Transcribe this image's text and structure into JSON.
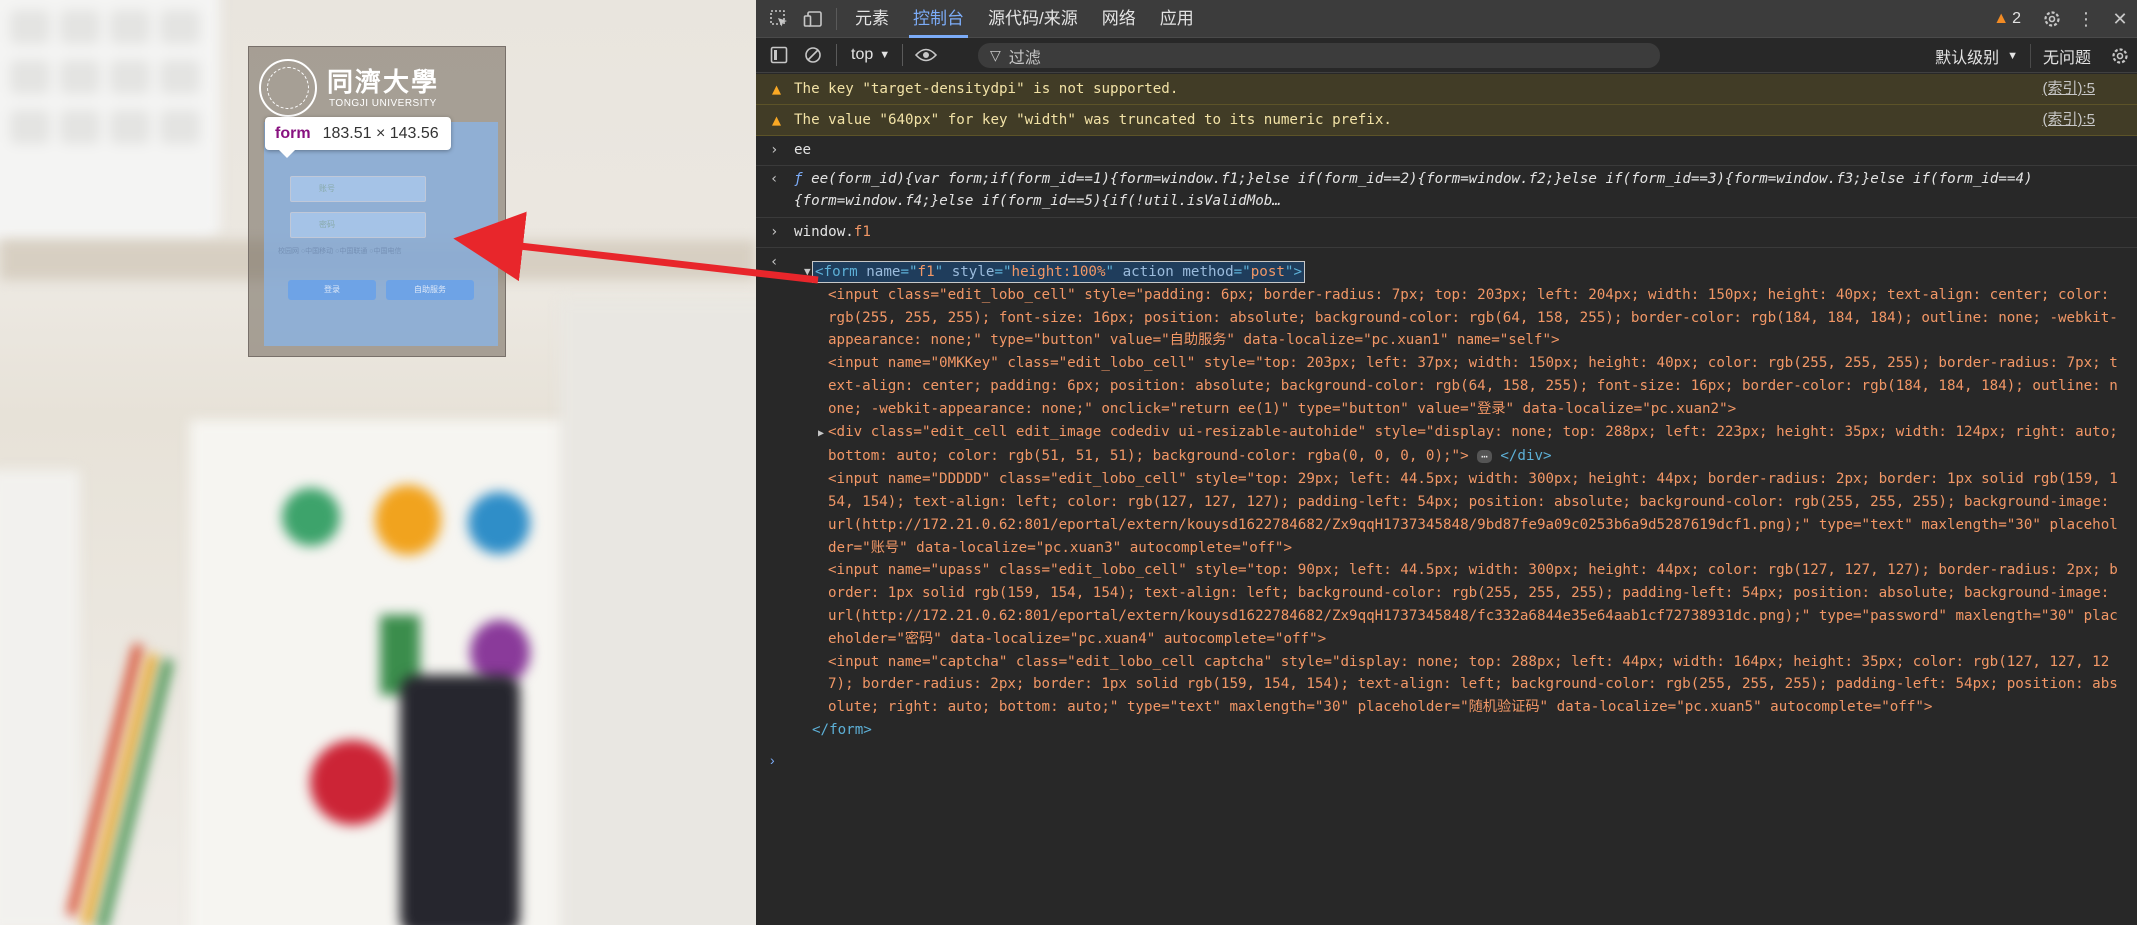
{
  "page": {
    "tongji_name_cn": "同濟大學",
    "tongji_name_en": "TONGJI UNIVERSITY",
    "login_form": {
      "account_placeholder": "账号",
      "password_placeholder": "密码",
      "radio_options": "校园网  ○中国移动  ○中国联通  ○中国电信",
      "login_btn": "登录",
      "self_service_btn": "自助服务"
    },
    "inspect_tooltip": {
      "tag": "form",
      "dims": "183.51 × 143.56"
    }
  },
  "devtools": {
    "tabs": [
      {
        "label": "元素",
        "active": false
      },
      {
        "label": "控制台",
        "active": true
      },
      {
        "label": "源代码/来源",
        "active": false
      },
      {
        "label": "网络",
        "active": false
      },
      {
        "label": "应用",
        "active": false
      }
    ],
    "issue_count": "2",
    "toolbar": {
      "context": "top",
      "filter_placeholder": "过滤",
      "level": "默认级别",
      "issues": "无问题"
    },
    "console": {
      "warnings": [
        {
          "text": "The key \"target-densitydpi\" is not supported.",
          "link": "(索引):5"
        },
        {
          "text": "The value \"640px\" for key \"width\" was truncated to its numeric prefix.",
          "link": "(索引):5"
        }
      ],
      "input1": "ee",
      "fn_output_line1": "ee(form_id){var form;if(form_id==1){form=window.f1;}else if(form_id==2){form=window.f2;}else if(form_id==3){form=window.f3;}else if(form_id==4)",
      "fn_output_line2": "{form=window.f4;}else if(form_id==5){if(!util.isValidMob…",
      "input2_obj": "window.",
      "input2_prop": "f1",
      "form_open": {
        "tag": "form",
        "name": "f1",
        "style": "height:100%",
        "action": "action",
        "method": "post"
      },
      "children": [
        {
          "id": "input1",
          "text": "<input class=\"edit_lobo_cell\" style=\"padding: 6px; border-radius: 7px; top: 203px; left: 204px; width: 150px; height: 40px; text-align: center; color: rgb(255, 255, 255); font-size: 16px; position: absolute; background-color: rgb(64, 158, 255); border-color: rgb(184, 184, 184); outline: none; -webkit-appearance: none;\" type=\"button\" value=\"自助服务\" data-localize=\"pc.xuan1\" name=\"self\">"
        },
        {
          "id": "input2",
          "text": "<input name=\"0MKKey\" class=\"edit_lobo_cell\" style=\"top: 203px; left: 37px; width: 150px; height: 40px; color: rgb(255, 255, 255); border-radius: 7px; text-align: center; padding: 6px; position: absolute; background-color: rgb(64, 158, 255); font-size: 16px; border-color: rgb(184, 184, 184); outline: none; -webkit-appearance: none;\" onclick=\"return ee(1)\" type=\"button\" value=\"登录\" data-localize=\"pc.xuan2\">"
        },
        {
          "id": "div1",
          "text": "<div class=\"edit_cell edit_image codediv ui-resizable-autohide\" style=\"display: none; top: 288px; left: 223px; height: 35px; width: 124px; right: auto; bottom: auto; color: rgb(51, 51, 51); background-color: rgba(0, 0, 0, 0);\">",
          "close": "</div>"
        },
        {
          "id": "input3",
          "text": "<input name=\"DDDDD\" class=\"edit_lobo_cell\" style=\"top: 29px; left: 44.5px; width: 300px; height: 44px; border-radius: 2px; border: 1px solid rgb(159, 154, 154); text-align: left; color: rgb(127, 127, 127); padding-left: 54px; position: absolute; background-color: rgb(255, 255, 255); background-image: url(http://172.21.0.62:801/eportal/extern/kouysd1622784682/Zx9qqH1737345848/9bd87fe9a09c0253b6a9d5287619dcf1.png);\" type=\"text\" maxlength=\"30\" placeholder=\"账号\" data-localize=\"pc.xuan3\" autocomplete=\"off\">"
        },
        {
          "id": "input4",
          "text": "<input name=\"upass\" class=\"edit_lobo_cell\" style=\"top: 90px; left: 44.5px; width: 300px; height: 44px; color: rgb(127, 127, 127); border-radius: 2px; border: 1px solid rgb(159, 154, 154); text-align: left; background-color: rgb(255, 255, 255); padding-left: 54px; position: absolute; background-image: url(http://172.21.0.62:801/eportal/extern/kouysd1622784682/Zx9qqH1737345848/fc332a6844e35e64aab1cf72738931dc.png);\" type=\"password\" maxlength=\"30\" placeholder=\"密码\" data-localize=\"pc.xuan4\" autocomplete=\"off\">"
        },
        {
          "id": "input5",
          "text": "<input name=\"captcha\" class=\"edit_lobo_cell captcha\" style=\"display: none; top: 288px; left: 44px; width: 164px; height: 35px; color: rgb(127, 127, 127); border-radius: 2px; border: 1px solid rgb(159, 154, 154); text-align: left; background-color: rgb(255, 255, 255); padding-left: 54px; position: absolute; right: auto; bottom: auto;\" type=\"text\" maxlength=\"30\" placeholder=\"随机验证码\" data-localize=\"pc.xuan5\" autocomplete=\"off\">"
        }
      ],
      "form_close": "</form>",
      "prompt": "›"
    }
  },
  "colors": {
    "accent": "#7cacf8",
    "warning_bg": "#413c26",
    "warning_icon": "#f9a825",
    "arrow": "#e8262b"
  }
}
